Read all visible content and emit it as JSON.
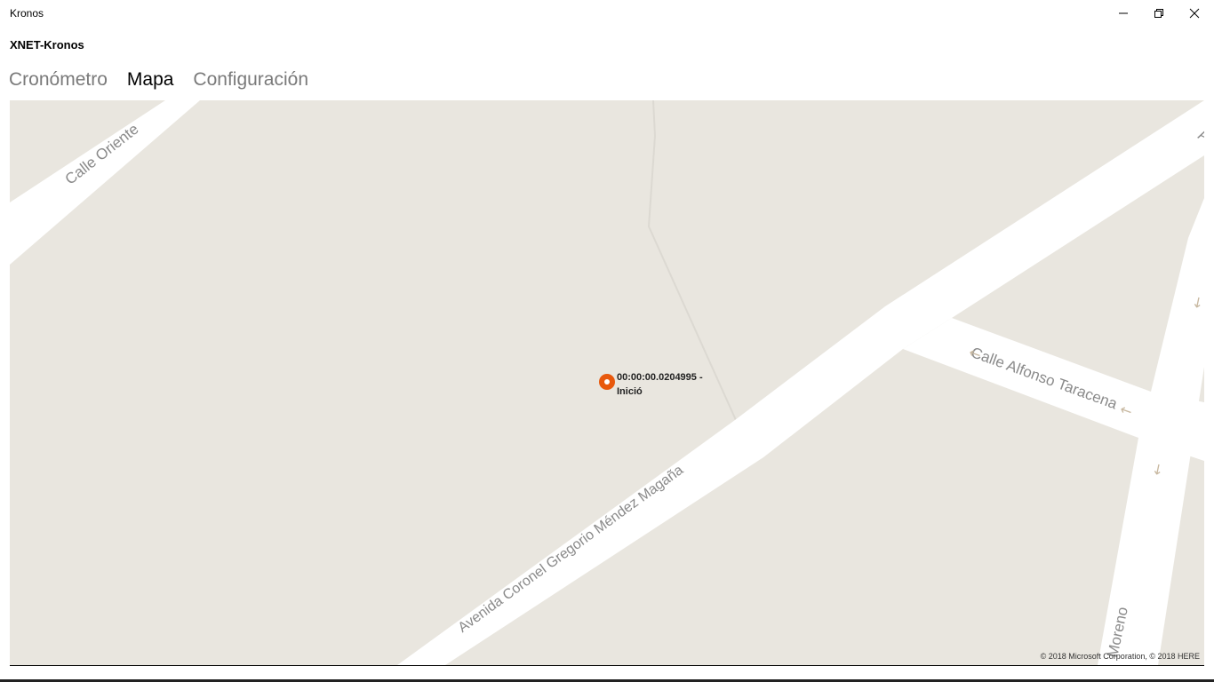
{
  "window": {
    "title": "Kronos"
  },
  "app": {
    "header": "XNET-Kronos"
  },
  "tabs": [
    {
      "label": "Cronómetro",
      "active": false
    },
    {
      "label": "Mapa",
      "active": true
    },
    {
      "label": "Configuración",
      "active": false
    }
  ],
  "map": {
    "streets": [
      "Calle Oriente",
      "Calle Alfonso Taracena",
      "Avenida Coronel Gregorio Méndez Magaña",
      "Moreno",
      "A"
    ],
    "one_way_arrows": [
      "←",
      "←",
      "↓",
      "↓"
    ],
    "pin": {
      "line1": "00:00:00.0204995 -",
      "line2": "Inició",
      "color": "#e8580c"
    },
    "copyright": "© 2018 Microsoft Corporation, © 2018 HERE",
    "colors": {
      "land": "#e9e6df",
      "road": "#ffffff",
      "label": "#8a8a8a"
    }
  }
}
